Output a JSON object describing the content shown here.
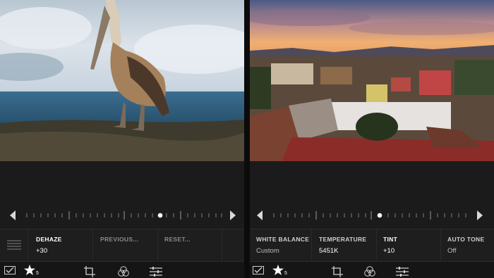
{
  "left_panel": {
    "adjustments": [
      {
        "label": "DEHAZE",
        "value": "+30"
      },
      {
        "label": "PREVIOUS...",
        "value": ""
      },
      {
        "label": "RESET...",
        "value": ""
      }
    ],
    "rating_badge": "5",
    "toolbar_icons": [
      "flag-icon",
      "star-icon",
      "crop-icon",
      "filter-icon",
      "sliders-icon"
    ]
  },
  "right_panel": {
    "adjustments": [
      {
        "label": "WHITE BALANCE",
        "value": "Custom"
      },
      {
        "label": "TEMPERATURE",
        "value": "5451K"
      },
      {
        "label": "TINT",
        "value": "+10"
      },
      {
        "label": "AUTO TONE",
        "value": "Off"
      }
    ],
    "rating_badge": "5",
    "toolbar_icons": [
      "flag-icon",
      "star-icon",
      "crop-icon",
      "filter-icon",
      "sliders-icon"
    ]
  },
  "colors": {
    "accent": "#ffffff",
    "panel_bg": "#1b1b1c",
    "label_active": "#ffffff",
    "label_dim": "#8a8a8a"
  }
}
